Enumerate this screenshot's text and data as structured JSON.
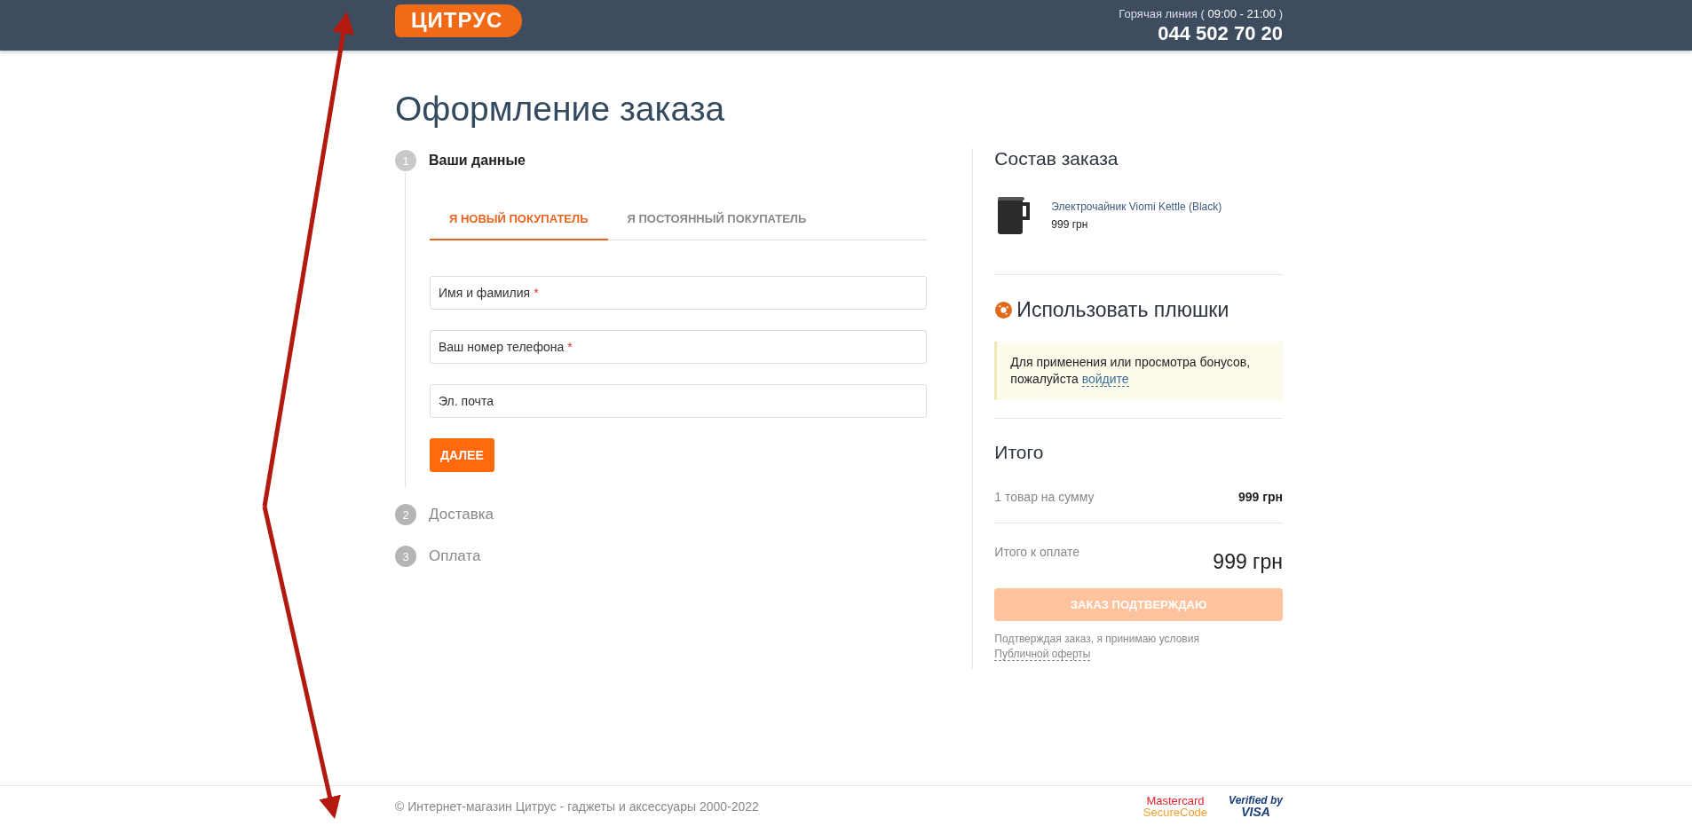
{
  "header": {
    "logo": "ЦИТРУС",
    "hotline": "Горячая линия ( **09:00 - 21:00** )",
    "phone": "044 502 70 20"
  },
  "page_title": "Оформление заказа",
  "steps": [
    {
      "number": "1",
      "label": "Ваши данные",
      "active": true
    },
    {
      "number": "2",
      "label": "Доставка",
      "active": false
    },
    {
      "number": "3",
      "label": "Оплата",
      "active": false
    }
  ],
  "customer_tabs": [
    {
      "label": "Я НОВЫЙ ПОКУПАТЕЛЬ",
      "selected": true
    },
    {
      "label": "Я ПОСТОЯННЫЙ ПОКУПАТЕЛЬ",
      "selected": false
    }
  ],
  "fields": [
    {
      "label": "Имя и фамилия",
      "required_mark": "*"
    },
    {
      "label": "Ваш номер телефона",
      "required_mark": "*"
    },
    {
      "label": "Эл. почта"
    }
  ],
  "next_button": "ДАЛЕЕ",
  "summary": {
    "title": "Состав заказа",
    "items": [
      {
        "name": "Электрочайник Viomi Kettle (Black)",
        "price": "999 грн"
      }
    ],
    "bonus_title": "Использовать плюшки",
    "bonus_notice": "Для применения или просмотра бонусов, пожалуйста",
    "bonus_link": "войдите",
    "total_title": "Итого",
    "subtotal_label": "1 товар на сумму",
    "subtotal_value": "999 грн",
    "total_label": "Итого к оплате",
    "total_value": "999 грн",
    "confirm_button": {
      "label": "ЗАКАЗ ПОДТВЕРЖДАЮ",
      "disabled": true
    },
    "terms_text": "Подтверждая заказ, я принимаю условия",
    "terms_link": "Публичной оферты"
  },
  "footer": {
    "copyright": "© Интернет-магазин Цитрус - гаджеты и аксессуары 2000-2022",
    "payment_badges": [
      {
        "kind": "mastercard",
        "lines": [
          "Mastercard",
          "SecureCode"
        ]
      },
      {
        "kind": "visa",
        "lines": [
          "Verified by",
          "VISA"
        ]
      }
    ]
  }
}
